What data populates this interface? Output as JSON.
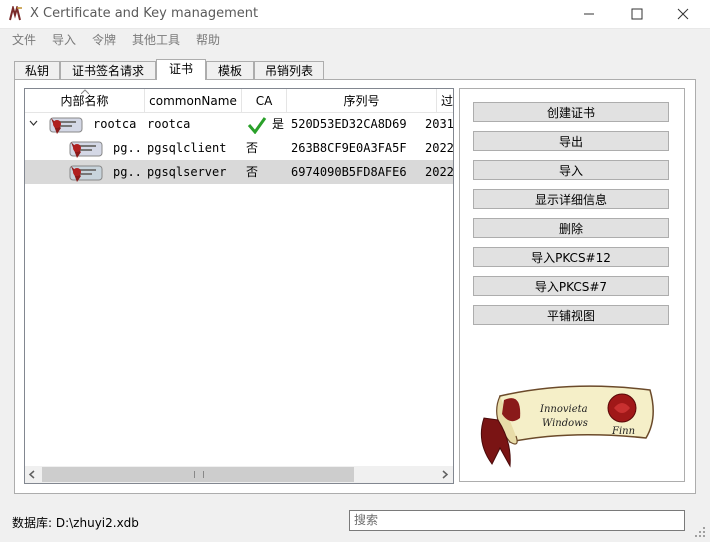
{
  "window": {
    "title": "X Certificate and Key management"
  },
  "menu": [
    "文件",
    "导入",
    "令牌",
    "其他工具",
    "帮助"
  ],
  "tabs": [
    {
      "label": "私钥",
      "active": false
    },
    {
      "label": "证书签名请求",
      "active": false
    },
    {
      "label": "证书",
      "active": true
    },
    {
      "label": "模板",
      "active": false
    },
    {
      "label": "吊销列表",
      "active": false
    }
  ],
  "tree": {
    "columns": [
      "内部名称",
      "commonName",
      "CA",
      "序列号",
      "过"
    ],
    "rows": [
      {
        "name": "rootca",
        "common_name": "rootca",
        "ca": "是",
        "ca_check": true,
        "serial": "520D53ED32CA8D69",
        "expiry": "2031",
        "expanded": true,
        "selected": false
      },
      {
        "name": "pg...",
        "common_name": "pgsqlclient",
        "ca": "否",
        "ca_check": false,
        "serial": "263B8CF9E0A3FA5F",
        "expiry": "2022",
        "expanded": false,
        "selected": false
      },
      {
        "name": "pg...",
        "common_name": "pgsqlserver",
        "ca": "否",
        "ca_check": false,
        "serial": "6974090B5FD8AFE6",
        "expiry": "2022",
        "expanded": false,
        "selected": true
      }
    ]
  },
  "buttons": {
    "create": "创建证书",
    "export": "导出",
    "import": "导入",
    "details": "显示详细信息",
    "delete": "删除",
    "import_pkcs12": "导入PKCS#12",
    "import_pkcs7": "导入PKCS#7",
    "flat_view": "平铺视图"
  },
  "logo": {
    "text_line1": "Innovieta",
    "text_line2": "Windows",
    "text_line3": "Finn"
  },
  "status": {
    "database": "数据库: D:\\zhuyi2.xdb"
  },
  "search": {
    "placeholder": "搜索"
  }
}
